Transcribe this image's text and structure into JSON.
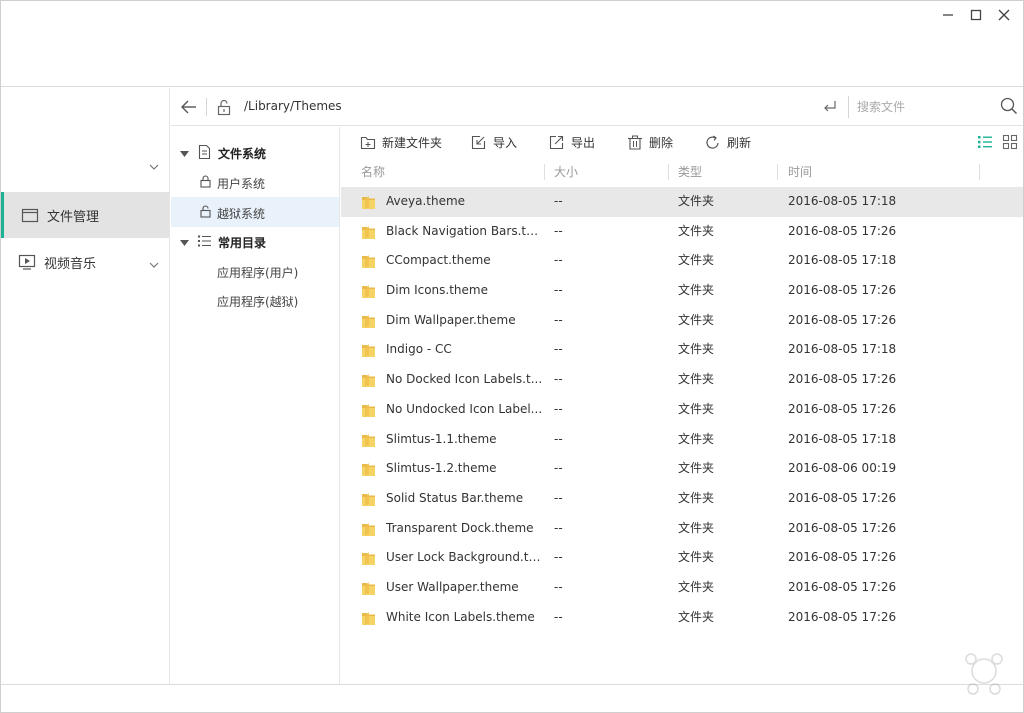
{
  "window": {
    "controls": [
      "minimize-icon",
      "maximize-icon",
      "close-icon"
    ]
  },
  "sidebar": {
    "items": [
      {
        "label": "文件管理",
        "icon": "folder-icon",
        "active": true
      },
      {
        "label": "视频音乐",
        "icon": "video-icon",
        "active": false
      }
    ]
  },
  "pathbar": {
    "path": "/Library/Themes",
    "search_placeholder": "搜索文件"
  },
  "tree": {
    "groups": [
      {
        "label": "文件系统",
        "children": [
          "用户系统",
          "越狱系统"
        ]
      },
      {
        "label": "常用目录",
        "children": [
          "应用程序(用户)",
          "应用程序(越狱)"
        ]
      }
    ]
  },
  "toolbar": {
    "new_folder": "新建文件夹",
    "import": "导入",
    "export": "导出",
    "delete": "删除",
    "refresh": "刷新"
  },
  "table": {
    "columns": [
      "名称",
      "大小",
      "类型",
      "时间"
    ],
    "rows": [
      {
        "name": "Aveya.theme",
        "size": "--",
        "type": "文件夹",
        "time": "2016-08-05 17:18",
        "selected": true
      },
      {
        "name": "Black Navigation Bars.the...",
        "size": "--",
        "type": "文件夹",
        "time": "2016-08-05 17:26"
      },
      {
        "name": "CCompact.theme",
        "size": "--",
        "type": "文件夹",
        "time": "2016-08-05 17:18"
      },
      {
        "name": "Dim Icons.theme",
        "size": "--",
        "type": "文件夹",
        "time": "2016-08-05 17:26"
      },
      {
        "name": "Dim Wallpaper.theme",
        "size": "--",
        "type": "文件夹",
        "time": "2016-08-05 17:26"
      },
      {
        "name": "Indigo - CC",
        "size": "--",
        "type": "文件夹",
        "time": "2016-08-05 17:18"
      },
      {
        "name": "No Docked Icon Labels.t...",
        "size": "--",
        "type": "文件夹",
        "time": "2016-08-05 17:26"
      },
      {
        "name": "No Undocked Icon Label...",
        "size": "--",
        "type": "文件夹",
        "time": "2016-08-05 17:26"
      },
      {
        "name": "Slimtus-1.1.theme",
        "size": "--",
        "type": "文件夹",
        "time": "2016-08-05 17:18"
      },
      {
        "name": "Slimtus-1.2.theme",
        "size": "--",
        "type": "文件夹",
        "time": "2016-08-06 00:19"
      },
      {
        "name": "Solid Status Bar.theme",
        "size": "--",
        "type": "文件夹",
        "time": "2016-08-05 17:26"
      },
      {
        "name": "Transparent Dock.theme",
        "size": "--",
        "type": "文件夹",
        "time": "2016-08-05 17:26"
      },
      {
        "name": "User Lock Background.th...",
        "size": "--",
        "type": "文件夹",
        "time": "2016-08-05 17:26"
      },
      {
        "name": "User Wallpaper.theme",
        "size": "--",
        "type": "文件夹",
        "time": "2016-08-05 17:26"
      },
      {
        "name": "White Icon Labels.theme",
        "size": "--",
        "type": "文件夹",
        "time": "2016-08-05 17:26"
      }
    ]
  },
  "colors": {
    "accent": "#1bb394",
    "list_view_active": "#1bb394",
    "folder": "#f2c94c",
    "selected_row": "#e8e8e8",
    "tree_selected": "#e9f1fb"
  }
}
